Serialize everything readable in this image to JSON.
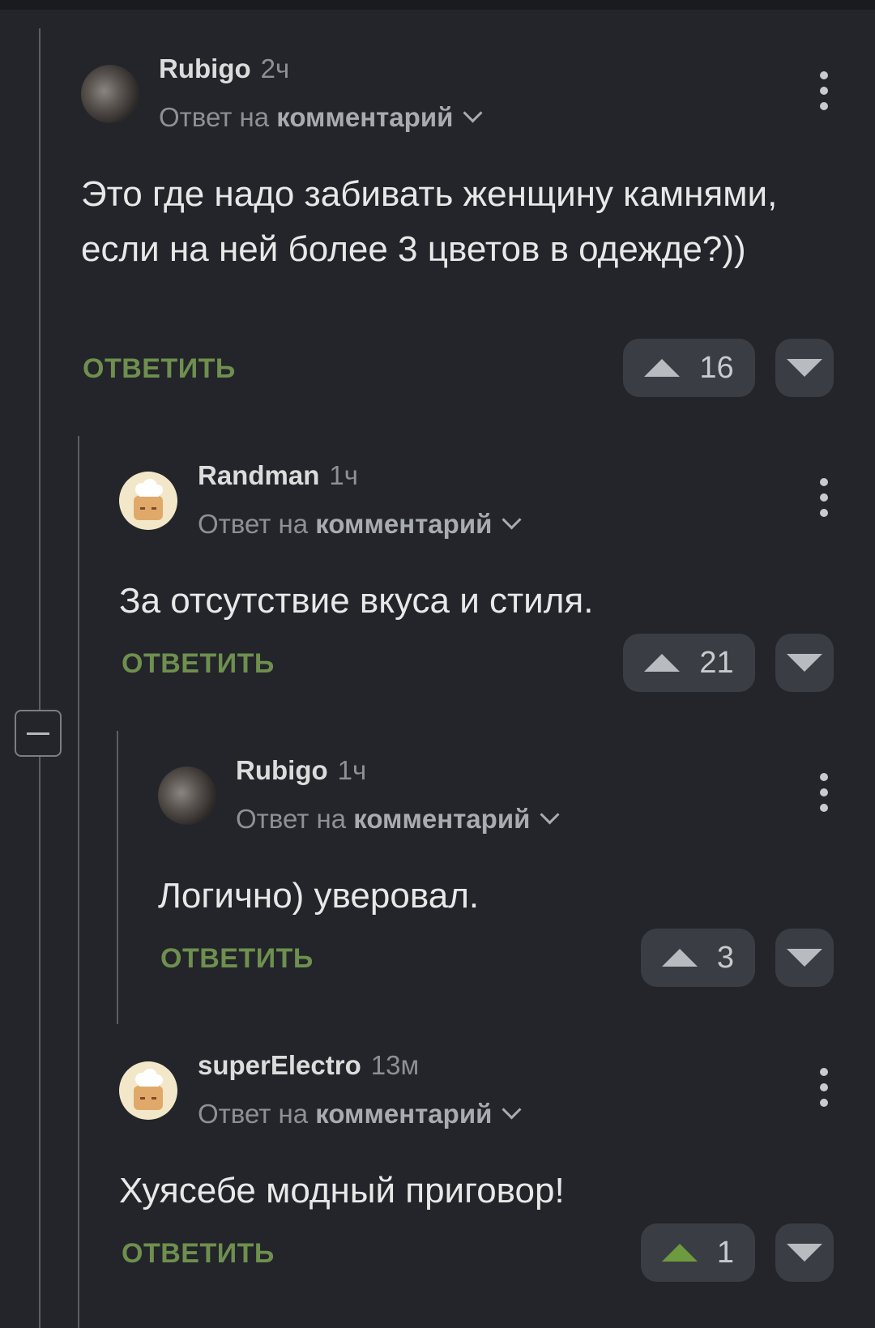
{
  "comments": [
    {
      "author": "Rubigo",
      "time": "2ч",
      "reply_prefix": "Ответ на",
      "reply_link": "комментарий",
      "text": "Это где надо забивать женщину камнями, если на ней более 3 цветов в одежде?))",
      "reply_label": "ОТВЕТИТЬ",
      "votes": "16",
      "avatar": "cat-avatar"
    },
    {
      "author": "Randman",
      "time": "1ч",
      "reply_prefix": "Ответ на",
      "reply_link": "комментарий",
      "text": "За отсутствие вкуса и стиля.",
      "reply_label": "ОТВЕТИТЬ",
      "votes": "21",
      "avatar": "chef-avatar"
    },
    {
      "author": "Rubigo",
      "time": "1ч",
      "reply_prefix": "Ответ на",
      "reply_link": "комментарий",
      "text": "Логично) уверовал.",
      "reply_label": "ОТВЕТИТЬ",
      "votes": "3",
      "avatar": "cat-avatar"
    },
    {
      "author": "superElectro",
      "time": "13м",
      "reply_prefix": "Ответ на",
      "reply_link": "комментарий",
      "text": "Хуясебе модный приговор!",
      "reply_label": "ОТВЕТИТЬ",
      "votes": "1",
      "avatar": "chef-avatar",
      "upvoted": true
    }
  ],
  "colors": {
    "background": "#23252a",
    "reply_green": "#6e8f4e",
    "upvote_active": "#6e9a3f"
  }
}
